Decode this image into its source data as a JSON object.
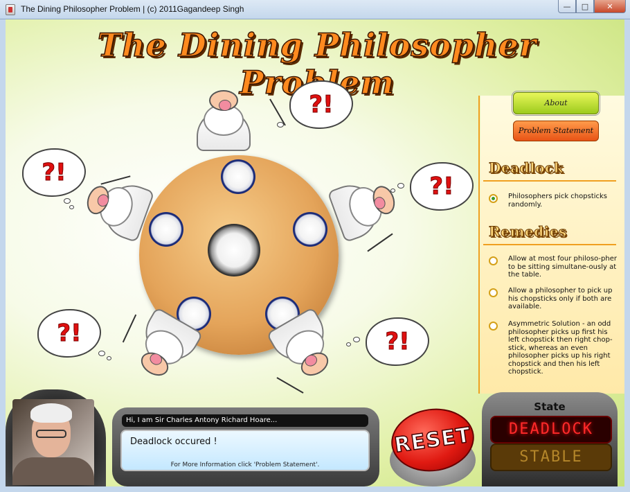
{
  "window": {
    "title": "The Dining Philosopher Problem | (c) 2011Gagandeep Singh",
    "min_glyph": "—",
    "max_glyph": "□",
    "close_glyph": "✕"
  },
  "app_title": "The Dining Philosopher Problem",
  "buttons": {
    "about": "About",
    "problem_statement": "Problem Statement",
    "reset": "RESET"
  },
  "deadlock_section": {
    "heading": "Deadlock",
    "options": [
      {
        "label": "Philosophers pick chopsticks randomly.",
        "selected": true
      }
    ]
  },
  "remedies_section": {
    "heading": "Remedies",
    "options": [
      {
        "label": "Allow at most four philoso-pher to be sitting simultane-ously at the table.",
        "selected": false
      },
      {
        "label": "Allow a philosopher to pick up his chopsticks only if both are available.",
        "selected": false
      },
      {
        "label": "Asymmetric Solution - an odd philosopher picks up first his left chopstick then right chop-stick, whereas an even philosopher picks up his right chopstick and then his left chopstick.",
        "selected": false
      }
    ]
  },
  "philosophers": [
    {
      "bubble_text": "?!"
    },
    {
      "bubble_text": "?!"
    },
    {
      "bubble_text": "?!"
    },
    {
      "bubble_text": "?!"
    },
    {
      "bubble_text": "?!"
    }
  ],
  "message": {
    "header": "Hi, I am Sir Charles Antony Richard Hoare...",
    "main": "Deadlock occured !",
    "note": "For More Information click 'Problem Statement'."
  },
  "state": {
    "label": "State",
    "deadlock": "DEADLOCK",
    "stable": "STABLE",
    "active": "deadlock"
  },
  "colors": {
    "accent_orange": "#f0a020",
    "about_green": "#9ccb1c",
    "problem_orange": "#e85316",
    "reset_red": "#e01a12",
    "deadlock_red": "#ff2a2a"
  },
  "icons": [
    "java-app-icon",
    "minimize-icon",
    "maximize-icon",
    "close-icon",
    "radio-icon",
    "speech-bubble-icon",
    "chopstick-icon"
  ]
}
